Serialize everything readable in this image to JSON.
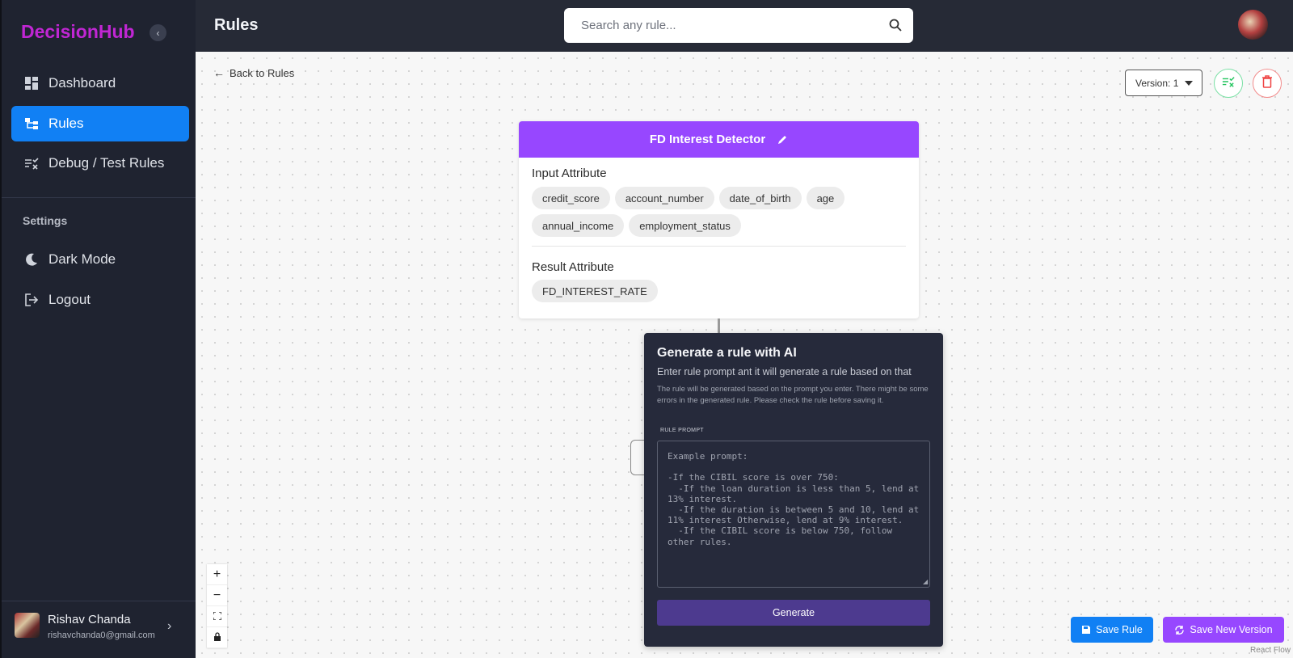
{
  "sidebar": {
    "brand": "DecisionHub",
    "collapse_icon": "chevron-left-icon",
    "items": [
      {
        "label": "Dashboard",
        "icon": "dashboard-icon",
        "active": false
      },
      {
        "label": "Rules",
        "icon": "rules-flow-icon",
        "active": true
      },
      {
        "label": "Debug / Test Rules",
        "icon": "debug-test-icon",
        "active": false
      }
    ],
    "settings_title": "Settings",
    "settings_items": [
      {
        "label": "Dark Mode",
        "icon": "moon-icon"
      },
      {
        "label": "Logout",
        "icon": "logout-icon"
      }
    ],
    "user": {
      "name": "Rishav Chanda",
      "email": "rishavchanda0@gmail.com"
    }
  },
  "header": {
    "title": "Rules",
    "search_placeholder": "Search any rule..."
  },
  "canvas": {
    "back_link": "Back to Rules",
    "version_label": "Version: 1",
    "rule_card": {
      "title": "FD Interest Detector",
      "input_title": "Input Attribute",
      "inputs": [
        "credit_score",
        "account_number",
        "date_of_birth",
        "age",
        "annual_income",
        "employment_status"
      ],
      "result_title": "Result Attribute",
      "results": [
        "FD_INTEREST_RATE"
      ]
    },
    "ai_panel": {
      "title": "Generate a rule with AI",
      "subtitle": "Enter rule prompt ant it will generate a rule based on that",
      "note": "The rule will be generated based on the prompt you enter. There might be some errors in the generated rule. Please check the rule before saving it.",
      "label": "RULE PROMPT",
      "placeholder": "Example prompt:\n\n-If the CIBIL score is over 750:\n  -If the loan duration is less than 5, lend at 13% interest.\n  -If the duration is between 5 and 10, lend at 11% interest Otherwise, lend at 9% interest.\n  -If the CIBIL score is below 750, follow other rules.",
      "button": "Generate"
    },
    "save_rule": "Save Rule",
    "save_new_version": "Save New Version",
    "attribution": "React Flow"
  },
  "colors": {
    "brand": "#c026d3",
    "active_nav": "#1180f4",
    "card_header": "#9747ff",
    "sidebar_bg": "#1f2330",
    "generate_button": "#4d3a8f"
  }
}
